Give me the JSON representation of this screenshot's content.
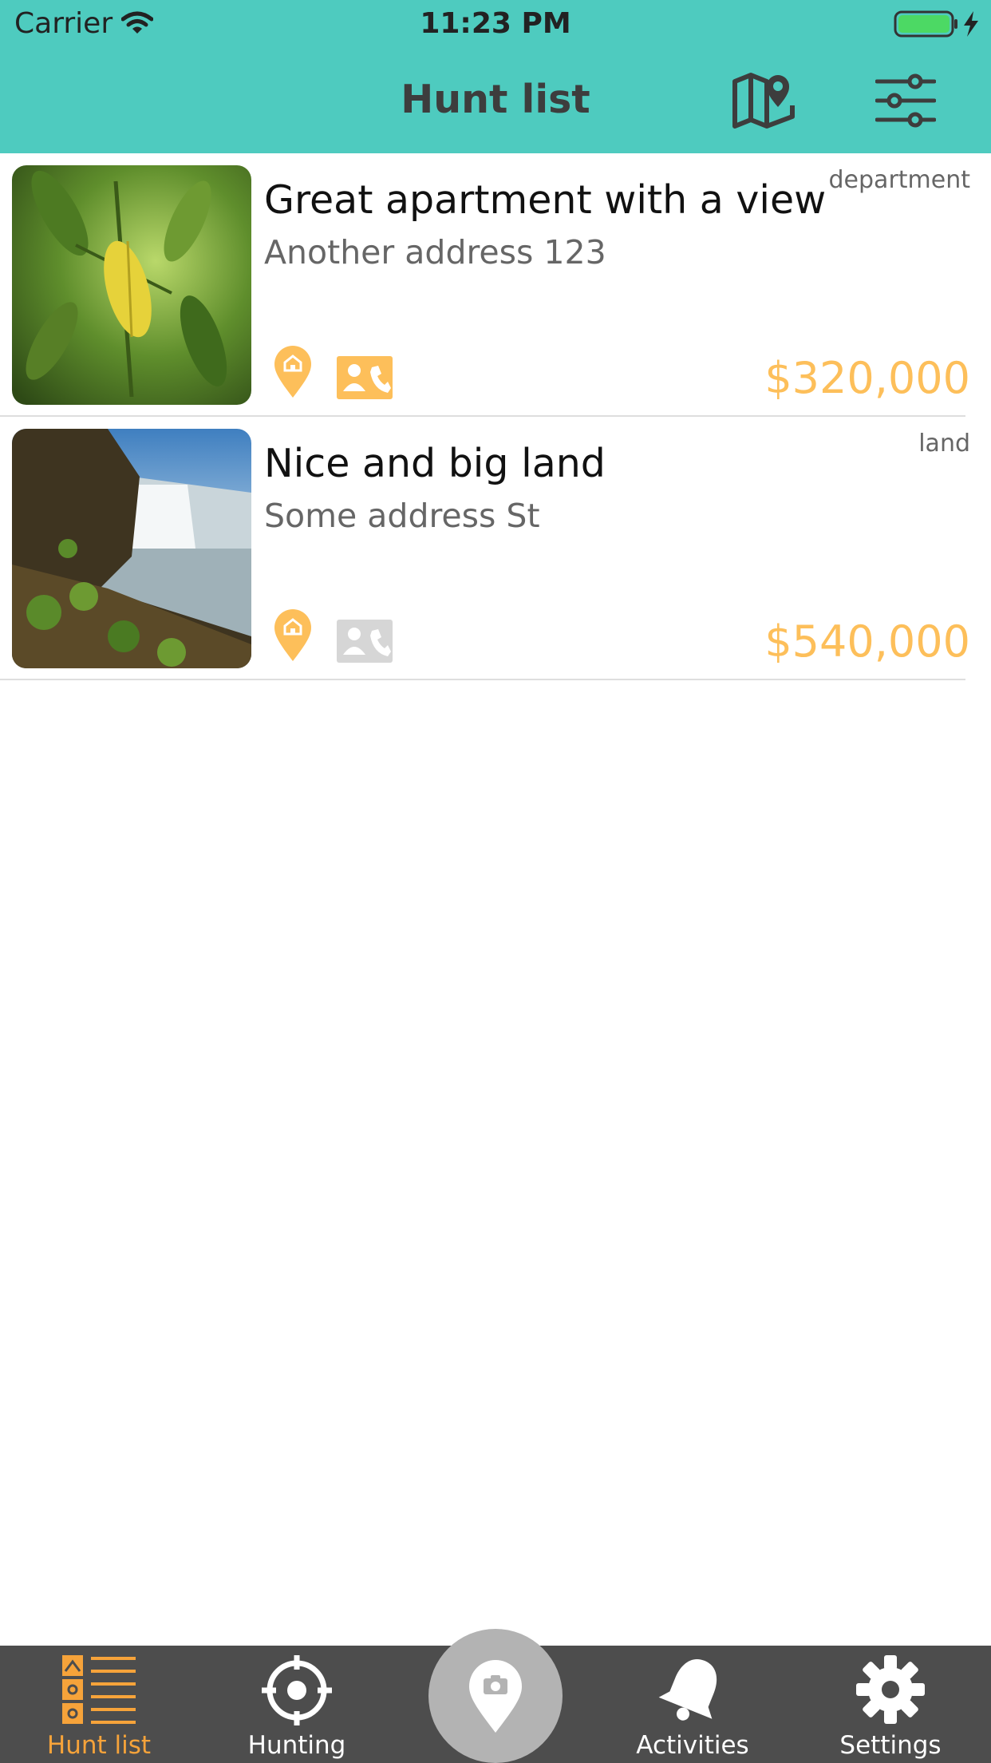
{
  "status_bar": {
    "carrier": "Carrier",
    "time": "11:23 PM"
  },
  "header": {
    "title": "Hunt list",
    "map_icon": "map-pin-icon",
    "filter_icon": "sliders-icon"
  },
  "listings": [
    {
      "title": "Great apartment with a view",
      "address": "Another address 123",
      "type": "department",
      "price": "$320,000",
      "photo": "leaves-photo",
      "contact_active": true
    },
    {
      "title": "Nice and big land",
      "address": "Some address St",
      "type": "land",
      "price": "$540,000",
      "photo": "waterfall-photo",
      "contact_active": false
    }
  ],
  "tabbar": {
    "tabs": [
      {
        "label": "Hunt list",
        "active": true
      },
      {
        "label": "Hunting",
        "active": false
      },
      {
        "label": "Activities",
        "active": false
      },
      {
        "label": "Settings",
        "active": false
      }
    ]
  },
  "colors": {
    "header_bg": "#4ecbbf",
    "accent": "#fdbf5a",
    "tabbar_bg": "#4d4d4d",
    "active_tab": "#f6a33a"
  }
}
